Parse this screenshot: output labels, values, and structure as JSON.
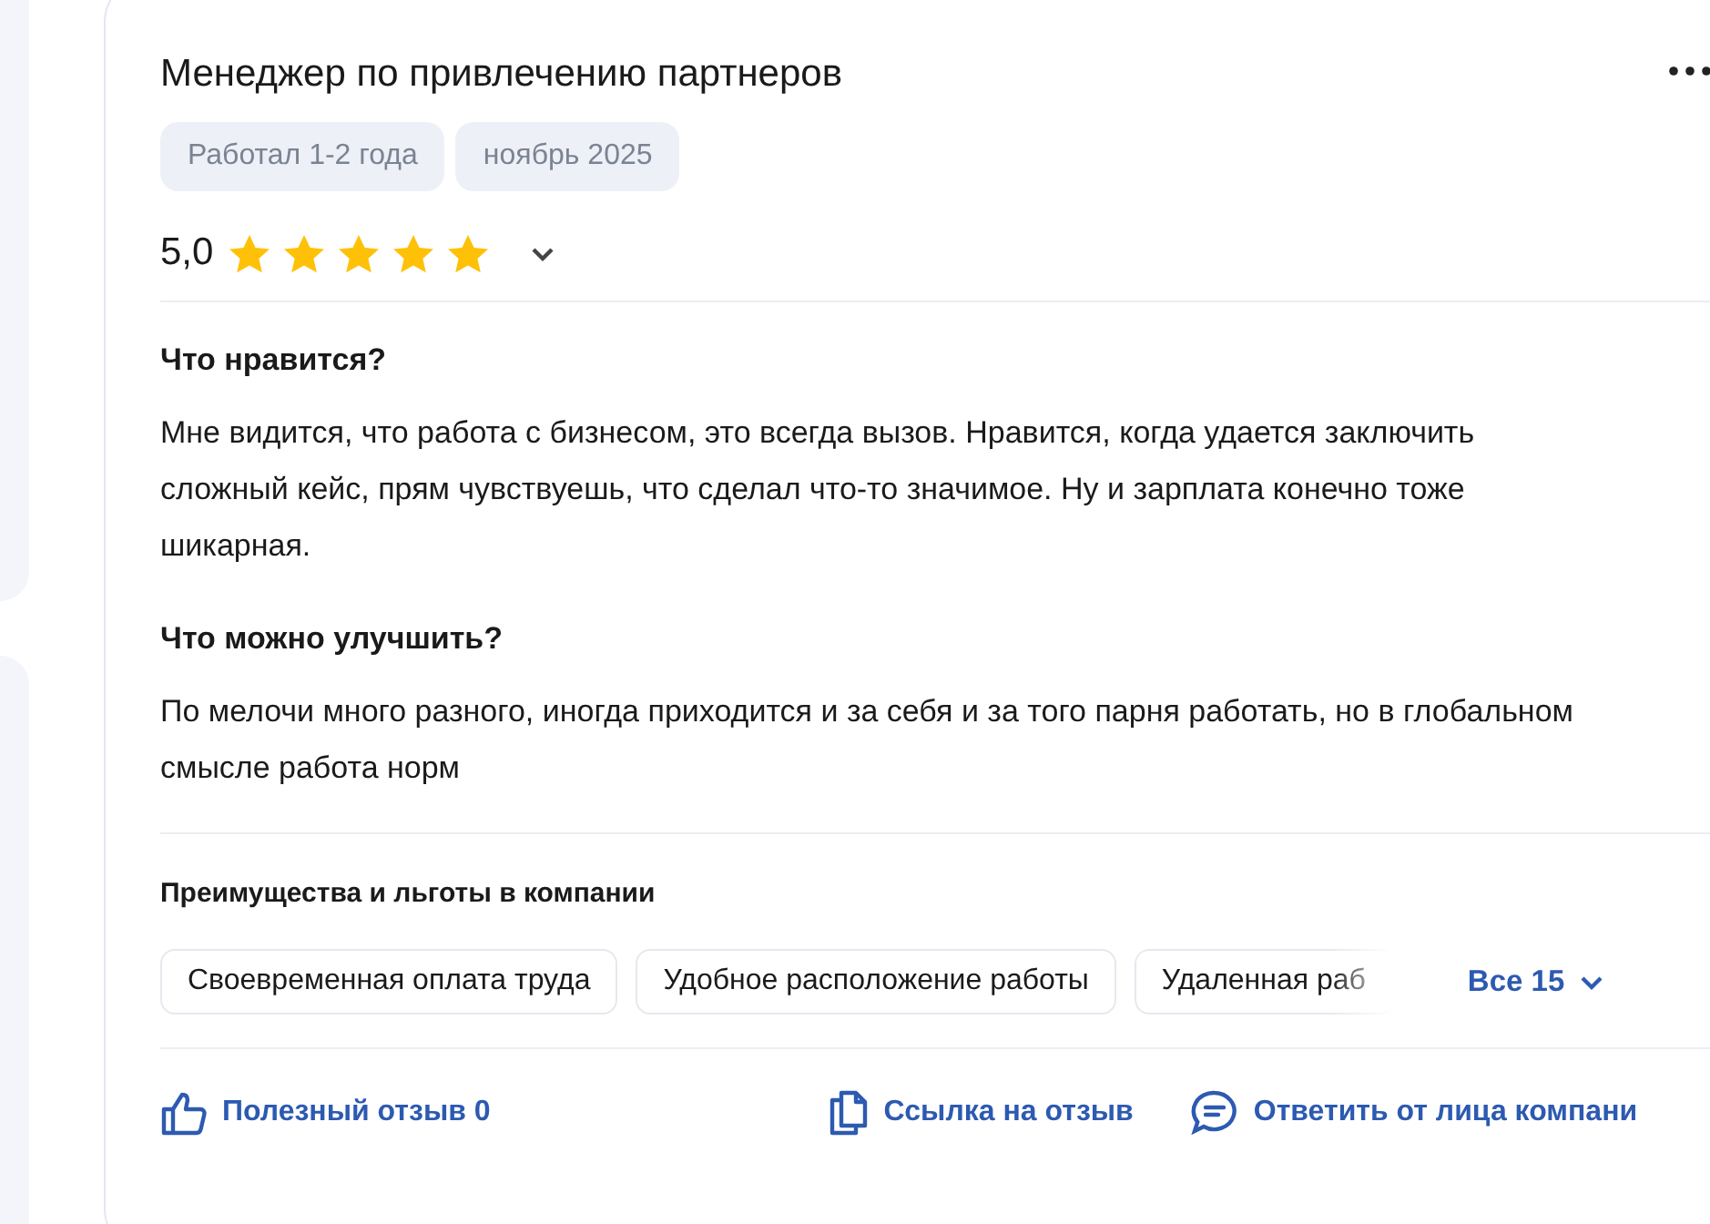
{
  "review": {
    "title": "Менеджер по привлечению партнеров",
    "tags": [
      "Работал 1-2 года",
      "ноябрь 2025"
    ],
    "rating": "5,0",
    "stars": 5,
    "sections": [
      {
        "heading": "Что нравится?",
        "text": "Мне видится, что работа с бизнесом, это всегда вызов. Нравится, когда удается заключить сложный кейс, прям чувствуешь, что сделал что-то значимое. Ну и зарплата конечно тоже шикарная."
      },
      {
        "heading": "Что можно улучшить?",
        "text": "По мелочи много разного, иногда приходится и за себя и за того парня работать, но в глобальном смысле работа норм"
      }
    ],
    "benefits": {
      "heading": "Преимущества и льготы в компании",
      "items": [
        "Своевременная оплата труда",
        "Удобное расположение работы",
        "Удаленная раб"
      ],
      "more": "Все 15"
    },
    "actions": [
      {
        "kind": "like",
        "label": "Полезный отзыв 0"
      },
      {
        "kind": "link",
        "label": "Ссылка на отзыв"
      },
      {
        "kind": "reply",
        "label": "Ответить от лица компани"
      }
    ]
  }
}
